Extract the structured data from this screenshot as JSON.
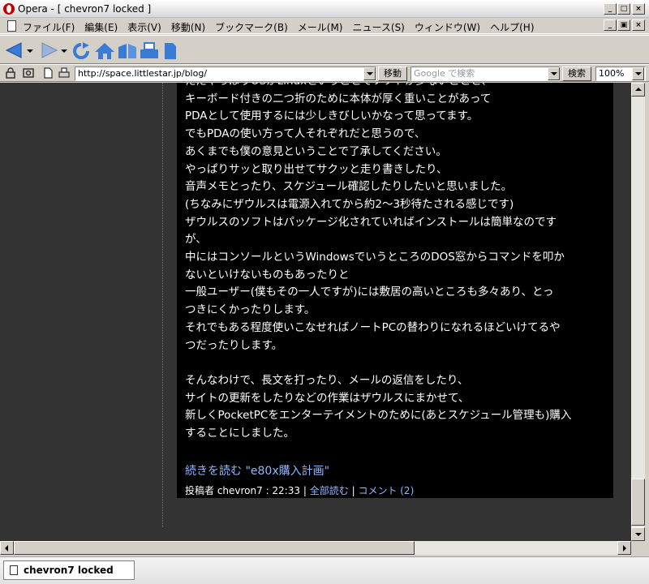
{
  "window": {
    "title": "Opera - [ chevron7 locked ]",
    "minimize_label": "_",
    "maximize_label": "□",
    "close_label": "×"
  },
  "menu": {
    "items": [
      {
        "label": "ファイル(F)"
      },
      {
        "label": "編集(E)"
      },
      {
        "label": "表示(V)"
      },
      {
        "label": "移動(N)"
      },
      {
        "label": "ブックマーク(B)"
      },
      {
        "label": "メール(M)"
      },
      {
        "label": "ニュース(S)"
      },
      {
        "label": "ウィンドウ(W)"
      },
      {
        "label": "ヘルプ(H)"
      }
    ],
    "mdi_minimize": "_",
    "mdi_restore": "▣",
    "mdi_close": "×"
  },
  "toolbar": {
    "icons": [
      "back-icon",
      "forward-icon",
      "reload-icon",
      "home-icon",
      "hotlist-icon",
      "print-icon",
      "page-icon"
    ]
  },
  "address": {
    "url": "http://space.littlestar.jp/blog/",
    "go_label": "移動",
    "search_placeholder": "Google で検索",
    "search_label": "検索",
    "zoom": "100%"
  },
  "post": {
    "cut_line": "ただやっぱりOSがLinuxということでソフトが少ないことと、",
    "lines": [
      "キーボード付きの二つ折のために本体が厚く重いことがあって",
      "PDAとして使用するには少しきびしいかなって思ってます。",
      "でもPDAの使い方って人それぞれだと思うので、",
      "あくまでも僕の意見ということで了承してください。",
      "やっぱりサッと取り出せてサクッと走り書きしたり、",
      "音声メモとったり、スケジュール確認したりしたいと思いました。",
      "(ちなみにザウルスは電源入れてから約2〜3秒待たされる感じです)",
      "ザウルスのソフトはパッケージ化されていればインストールは簡単なのです",
      "が、",
      "中にはコンソールというWindowsでいうところのDOS窓からコマンドを叩か",
      "ないといけないものもあったりと",
      "一般ユーザー(僕もその一人ですが)には敷居の高いところも多々あり、とっ",
      "つきにくかったりします。",
      "それでもある程度使いこなせればノートPCの替わりになれるほどいけてるや",
      "つだったりします。"
    ],
    "lines2": [
      "そんなわけで、長文を打ったり、メールの返信をしたり、",
      "サイトの更新をしたりなどの作業はザウルスにまかせて、",
      "新しくPocketPCをエンターテイメントのために(あとスケジュール管理も)購入",
      "することにしました。"
    ],
    "more_link": "続きを読む \"e80x購入計画\"",
    "footer": {
      "posted_by_label": "投稿者 chevron7 : 22:33",
      "separator1": "|",
      "read_all": "全部読む",
      "separator2": "|",
      "comments": "コメント (2)"
    }
  },
  "tab": {
    "label": "chevron7 locked"
  },
  "colors": {
    "page_bg": "#333333",
    "content_bg": "#000000",
    "text": "#ffffff",
    "link": "#8fb8ff"
  }
}
